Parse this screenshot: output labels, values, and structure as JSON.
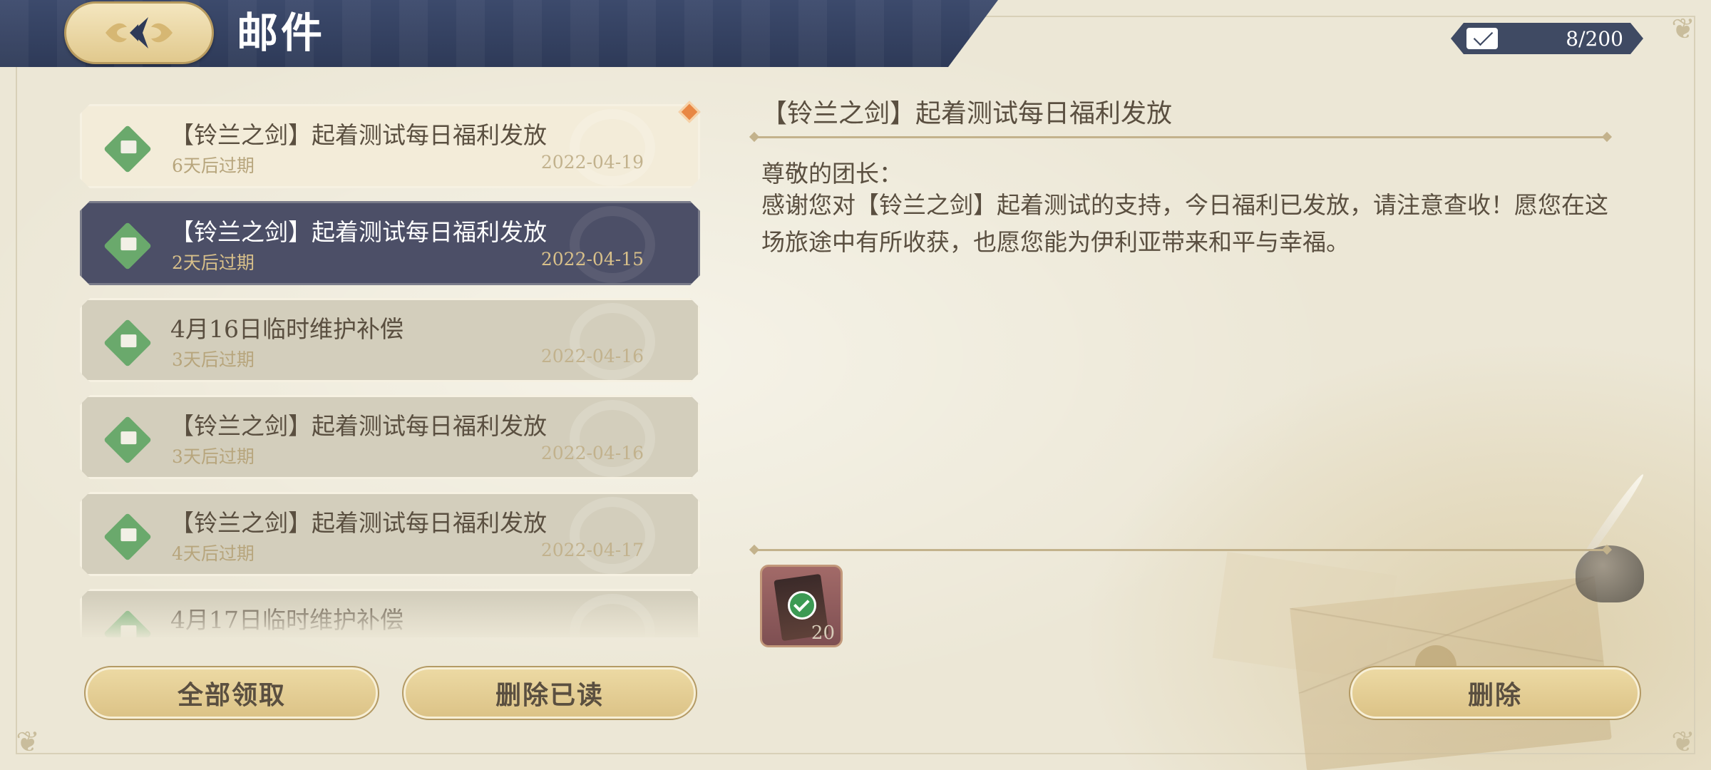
{
  "header": {
    "title": "邮件",
    "mail_count": "8/200",
    "back_icon": "back-arrow-icon",
    "mail_icon": "envelope-icon"
  },
  "mail_list": [
    {
      "subject": "【铃兰之剑】起着测试每日福利发放",
      "expiry": "6天后过期",
      "date": "2022-04-19",
      "state": "unread"
    },
    {
      "subject": "【铃兰之剑】起着测试每日福利发放",
      "expiry": "2天后过期",
      "date": "2022-04-15",
      "state": "selected"
    },
    {
      "subject": "4月16日临时维护补偿",
      "expiry": "3天后过期",
      "date": "2022-04-16",
      "state": "read"
    },
    {
      "subject": "【铃兰之剑】起着测试每日福利发放",
      "expiry": "3天后过期",
      "date": "2022-04-16",
      "state": "read"
    },
    {
      "subject": "【铃兰之剑】起着测试每日福利发放",
      "expiry": "4天后过期",
      "date": "2022-04-17",
      "state": "read"
    },
    {
      "subject": "4月17日临时维护补偿",
      "expiry": "",
      "date": "",
      "state": "read"
    }
  ],
  "buttons": {
    "claim_all": "全部领取",
    "delete_read": "删除已读",
    "delete": "删除"
  },
  "detail": {
    "title": "【铃兰之剑】起着测试每日福利发放",
    "greeting": "尊敬的团长：",
    "body": "感谢您对【铃兰之剑】起着测试的支持，今日福利已发放，请注意查收！愿您在这场旅途中有所收获，也愿您能为伊利亚带来和平与幸福。",
    "attachment": {
      "quantity": "20",
      "claimed": true
    }
  },
  "colors": {
    "header_bg": "#2e3a58",
    "selected_item": "#4c4f67",
    "button_gold": "#e4cd95",
    "icon_green": "#6aa96c"
  }
}
